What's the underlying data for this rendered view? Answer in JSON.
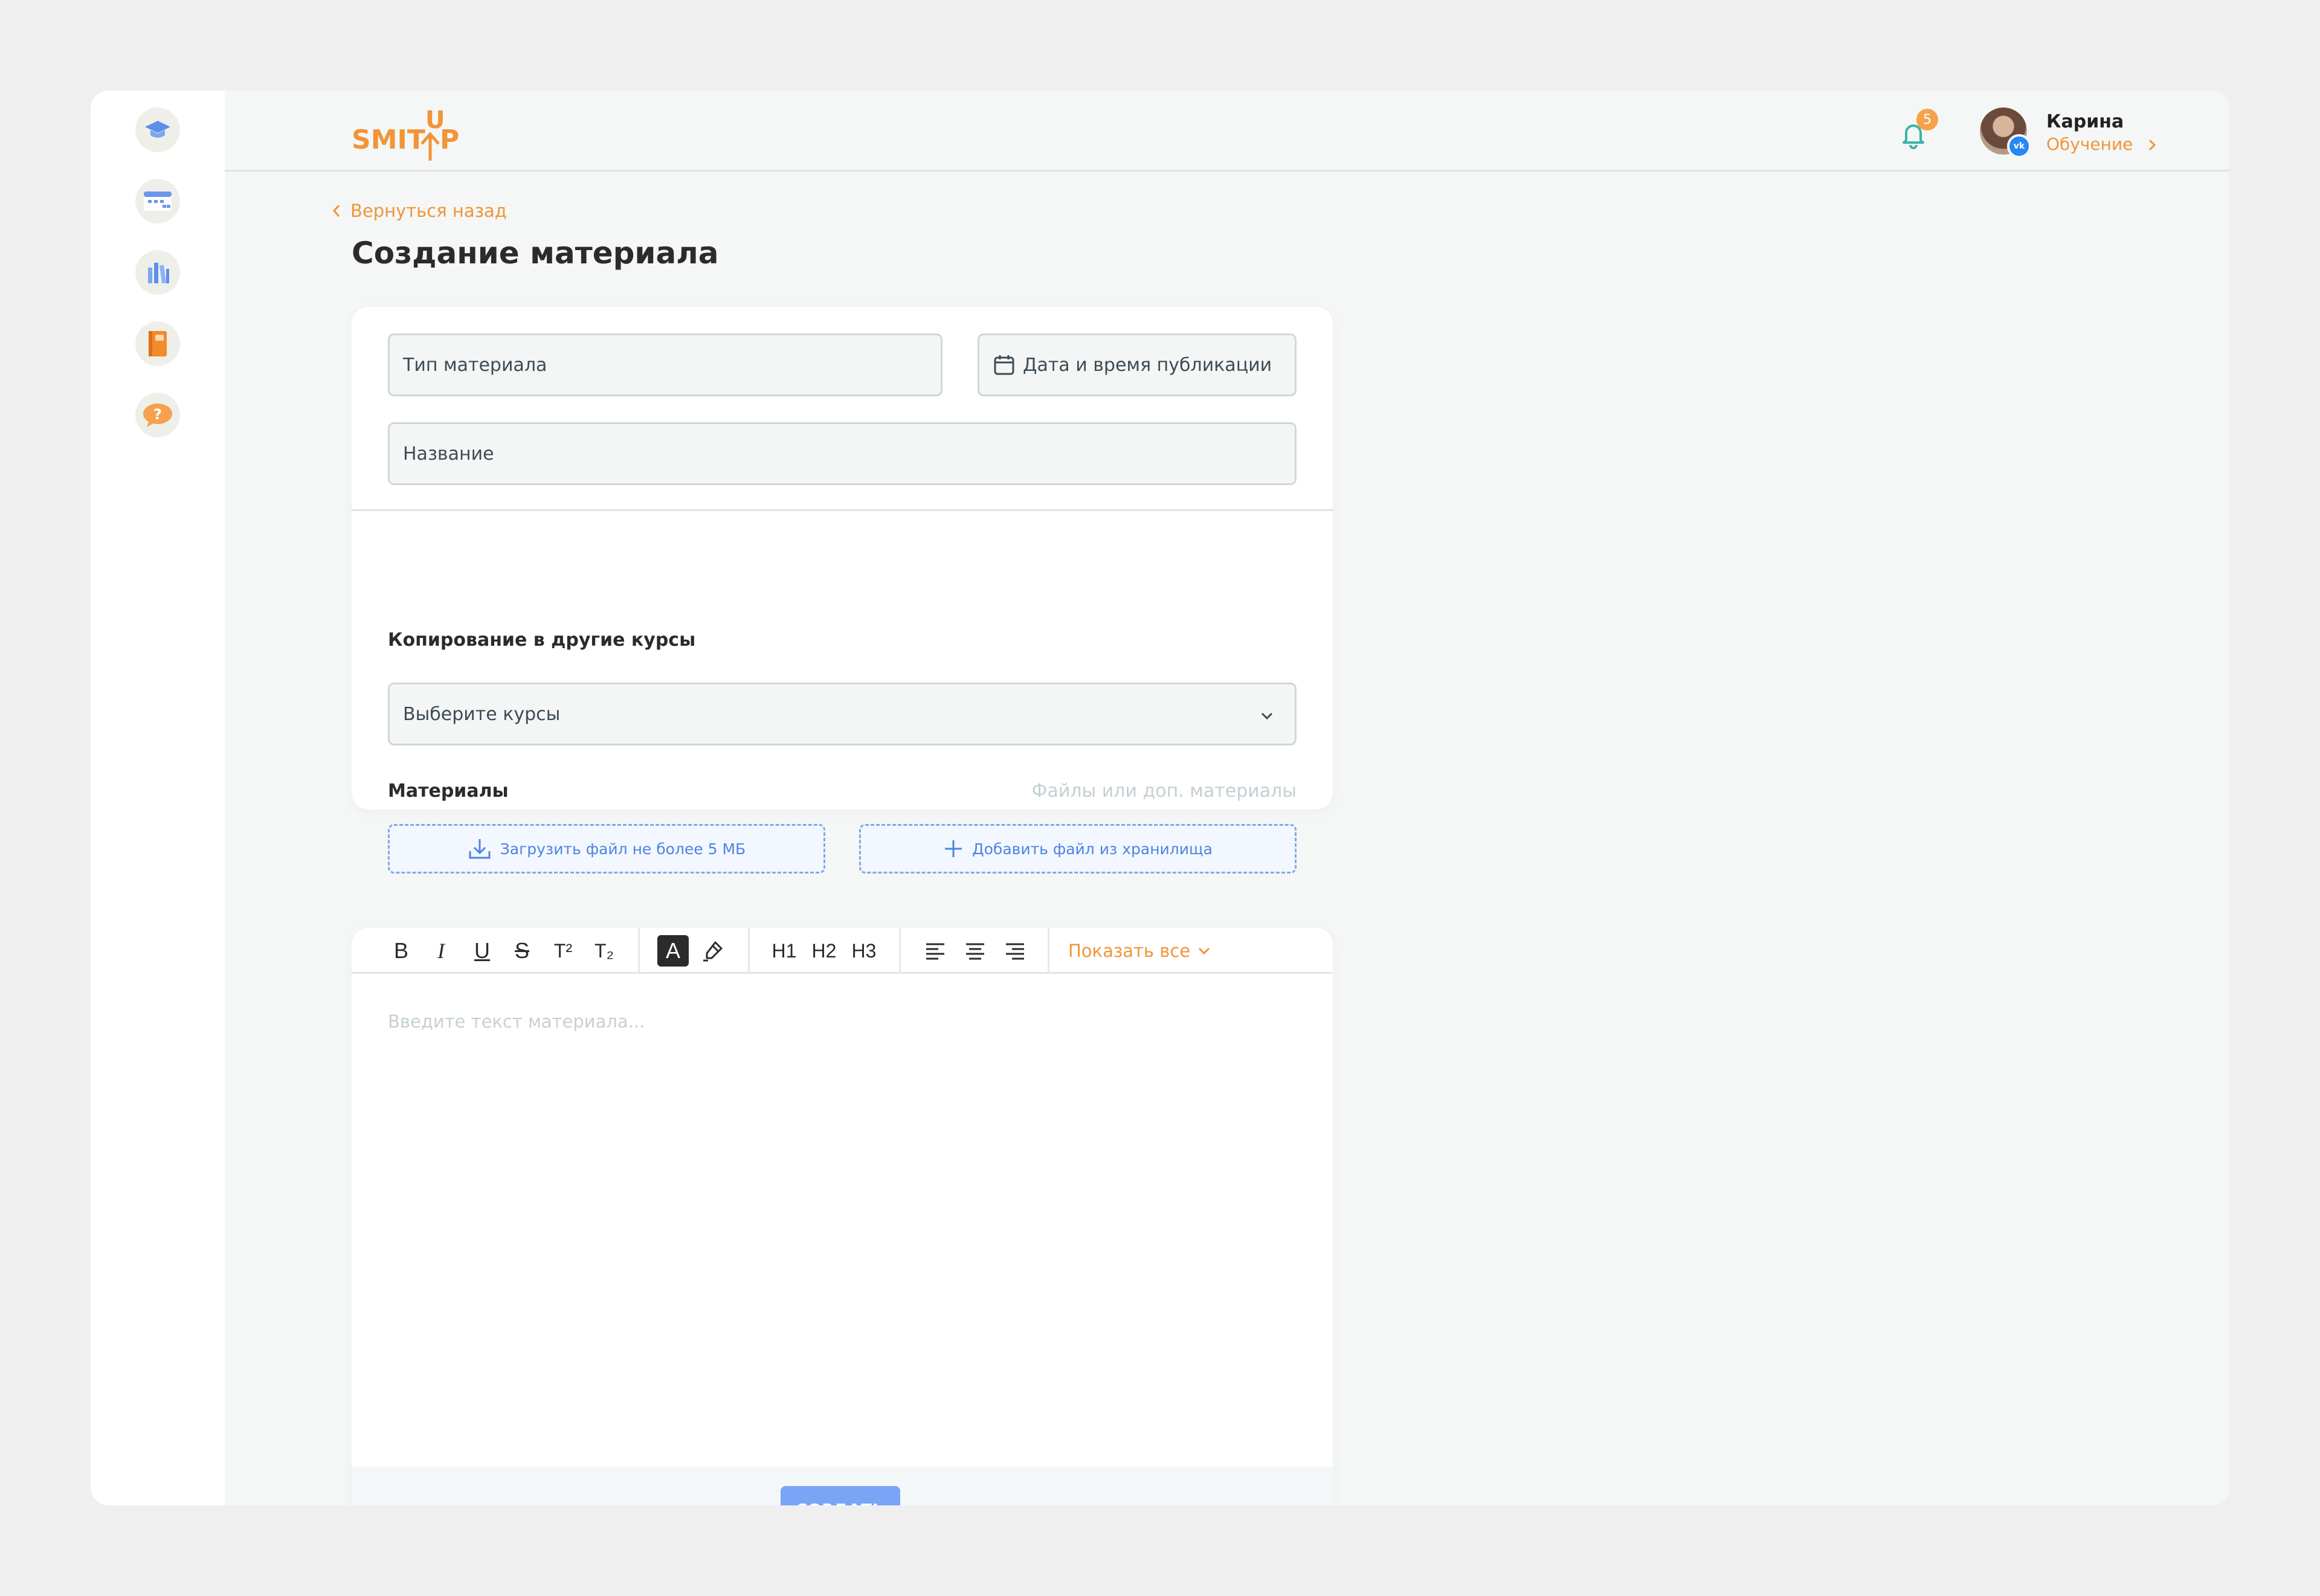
{
  "brand": {
    "logo_text": "SMITUP",
    "accent": "#f29437"
  },
  "sidebar": {
    "items": [
      {
        "icon": "graduation-cap-icon"
      },
      {
        "icon": "calendar-schedule-icon"
      },
      {
        "icon": "library-books-icon"
      },
      {
        "icon": "notebook-icon"
      },
      {
        "icon": "help-question-icon"
      }
    ]
  },
  "header": {
    "notifications_count": "5",
    "user": {
      "name": "Карина",
      "role": "Обучение",
      "social": "vk"
    }
  },
  "nav": {
    "back_label": "Вернуться назад"
  },
  "page": {
    "title": "Создание материала"
  },
  "form": {
    "type_placeholder": "Тип материала",
    "date_placeholder": "Дата и время публикации",
    "name_placeholder": "Название",
    "copy_section_label": "Копирование в другие курсы",
    "courses_placeholder": "Выберите курсы",
    "materials_label": "Материалы",
    "materials_hint": "Файлы или доп. материалы",
    "upload_label": "Загрузить файл не более 5 МБ",
    "storage_label": "Добавить файл из хранилища"
  },
  "editor": {
    "toolbar": {
      "bold": "B",
      "italic": "I",
      "underline": "U",
      "strike": "S",
      "superscript": "T²",
      "subscript": "T₂",
      "text_color": "A",
      "h1": "H1",
      "h2": "H2",
      "h3": "H3",
      "show_all": "Показать все"
    },
    "placeholder": "Введите текст материала..."
  },
  "footer": {
    "create_label": "СОЗДАТЬ"
  }
}
